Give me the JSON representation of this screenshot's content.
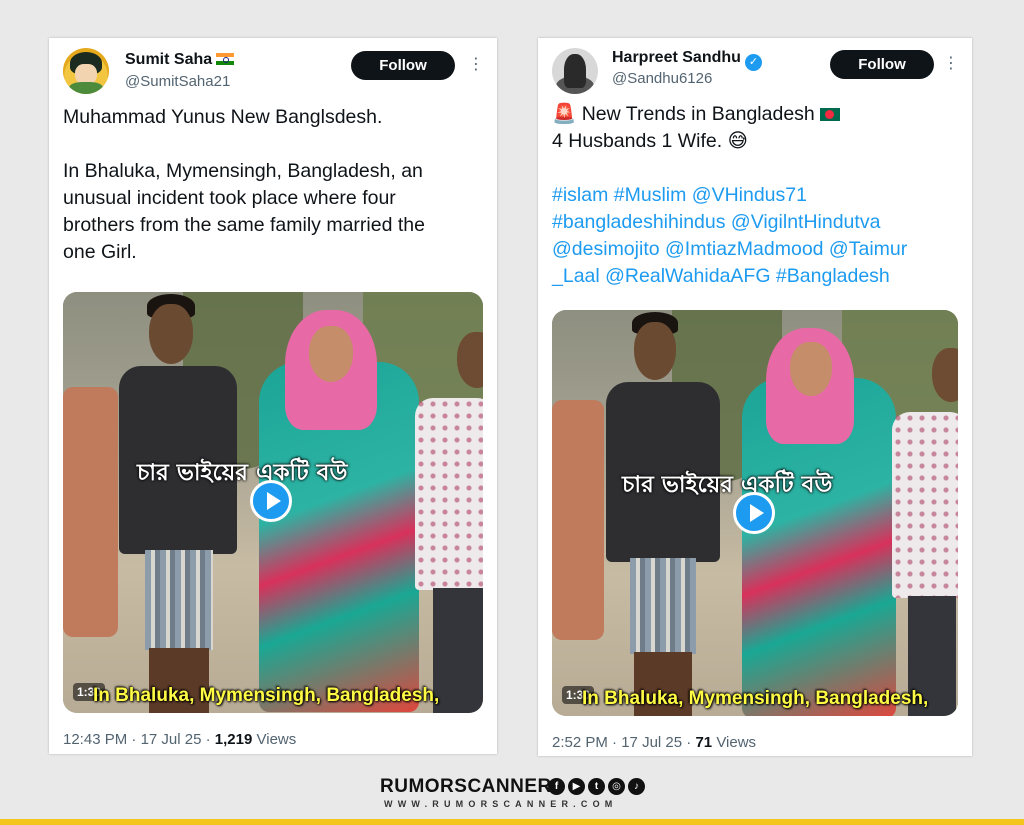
{
  "tweets": [
    {
      "author_name": "Sumit Saha",
      "author_handle": "@SumitSaha21",
      "author_flag_icon": "india-flag-icon",
      "follow_label": "Follow",
      "text_lines": [
        "Muhammad Yunus New Banglsdesh.",
        "",
        "In Bhaluka, Mymensingh, Bangladesh, an",
        "unusual incident took place where four",
        "brothers from the same family married the",
        "one Girl."
      ],
      "video": {
        "overlay_text": "চার ভাইয়ের একটি বউ",
        "duration": "1:30",
        "subtitle": "In Bhaluka, Mymensingh, Bangladesh,"
      },
      "time": "12:43 PM",
      "date": "17 Jul 25",
      "views_count": "1,219",
      "views_label": "Views"
    },
    {
      "author_name": "Harpreet Sandhu",
      "author_handle": "@Sandhu6126",
      "verified": true,
      "follow_label": "Follow",
      "text_line1": "New Trends in Bangladesh",
      "text_line2": "4 Husbands 1 Wife.",
      "hashtag_lines": [
        "#islam #Muslim @VHindus71",
        "#bangladeshihindus  @VigilntHindutva",
        "@desimojito @ImtiazMadmood @Taimur",
        "_Laal @RealWahidaAFG #Bangladesh"
      ],
      "video": {
        "overlay_text": "চার ভাইয়ের একটি বউ",
        "duration": "1:30",
        "subtitle": "In Bhaluka, Mymensingh, Bangladesh,"
      },
      "time": "2:52 PM",
      "date": "17 Jul 25",
      "views_count": "71",
      "views_label": "Views"
    }
  ],
  "branding": {
    "name": "RUMORSCANNER",
    "website": "WWW.RUMORSCANNER.COM",
    "social_icons": [
      "facebook-icon",
      "youtube-icon",
      "twitter-icon",
      "instagram-icon",
      "tiktok-icon"
    ]
  },
  "colors": {
    "link": "#1d9bf0",
    "follow_button": "#0f1419",
    "accent_bar": "#f4c51c"
  }
}
